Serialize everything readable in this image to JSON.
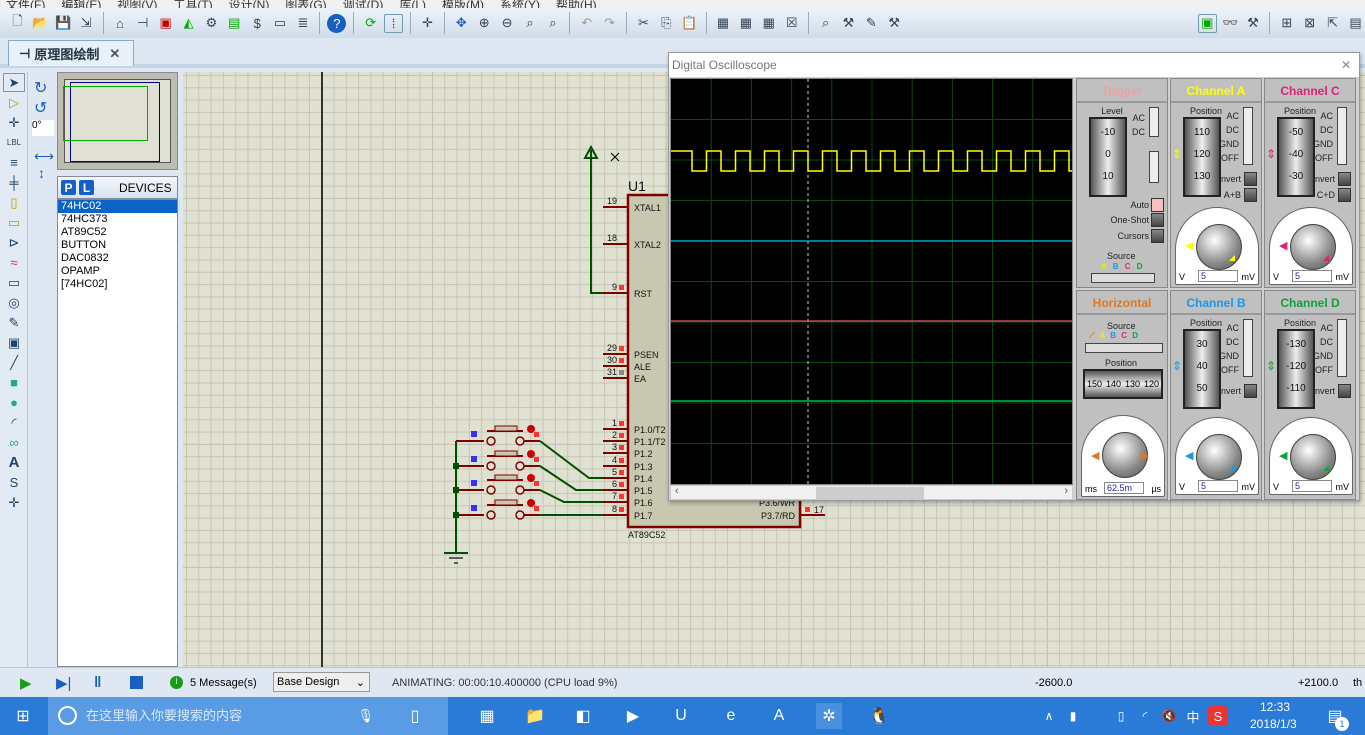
{
  "menu": [
    "文件(F)",
    "编辑(E)",
    "视图(V)",
    "工具(T)",
    "设计(N)",
    "图表(G)",
    "调试(D)",
    "库(L)",
    "模版(M)",
    "系统(Y)",
    "帮助(H)"
  ],
  "tab": {
    "label": "原理图绘制",
    "close": "✕"
  },
  "rotation": "0°",
  "devices": {
    "p": "P",
    "l": "L",
    "title": "DEVICES",
    "items": [
      "74HC02",
      "74HC373",
      "AT89C52",
      "BUTTON",
      "DAC0832",
      "OPAMP",
      "[74HC02]"
    ],
    "selected": "74HC02"
  },
  "schematic": {
    "ref": "U1",
    "part": "AT89C52",
    "pins": [
      {
        "n": "19",
        "name": "XTAL1"
      },
      {
        "n": "18",
        "name": "XTAL2"
      },
      {
        "n": "9",
        "name": "RST"
      },
      {
        "n": "29",
        "name": "PSEN"
      },
      {
        "n": "30",
        "name": "ALE"
      },
      {
        "n": "31",
        "name": "EA"
      },
      {
        "n": "1",
        "name": "P1.0/T2"
      },
      {
        "n": "2",
        "name": "P1.1/T2"
      },
      {
        "n": "3",
        "name": "P1.2"
      },
      {
        "n": "4",
        "name": "P1.3"
      },
      {
        "n": "5",
        "name": "P1.4"
      },
      {
        "n": "6",
        "name": "P1.5"
      },
      {
        "n": "7",
        "name": "P1.6"
      },
      {
        "n": "8",
        "name": "P1.7"
      }
    ],
    "right_pins": [
      {
        "n": "",
        "name": "P3.6/WR"
      },
      {
        "n": "17",
        "name": "P3.7/RD"
      }
    ]
  },
  "scope": {
    "title": "Digital Oscilloscope",
    "close": "✕",
    "traces": {
      "A": "#ffff00",
      "B": "#00c8e8",
      "C": "#e05070",
      "D": "#00e060"
    },
    "trigger": {
      "title": "Trigger",
      "level": "Level",
      "ticks": [
        "-10",
        "0",
        "10"
      ],
      "ac": "AC",
      "dc": "DC",
      "auto": "Auto",
      "oneshot": "One-Shot",
      "cursors": "Cursors",
      "source": "Source",
      "src": [
        "A",
        "B",
        "C",
        "D"
      ]
    },
    "horizontal": {
      "title": "Horizontal",
      "source": "Source",
      "src": [
        "A",
        "B",
        "C",
        "D"
      ],
      "position": "Position",
      "ticks": [
        "150",
        "140",
        "130",
        "120"
      ],
      "value": "62.5m",
      "unit_l": "ms",
      "unit_r": "µs"
    },
    "channels": [
      {
        "id": "A",
        "title": "Channel A",
        "color": "#ffff00",
        "ticks": [
          "110",
          "120",
          "130"
        ],
        "extra": "A+B",
        "value": "5"
      },
      {
        "id": "C",
        "title": "Channel C",
        "color": "#e0207a",
        "ticks": [
          "-50",
          "-40",
          "-30"
        ],
        "extra": "C+D",
        "value": "5"
      },
      {
        "id": "B",
        "title": "Channel B",
        "color": "#1e96e6",
        "ticks": [
          "30",
          "40",
          "50"
        ],
        "extra": "",
        "value": "5"
      },
      {
        "id": "D",
        "title": "Channel D",
        "color": "#10a040",
        "ticks": [
          "-130",
          "-120",
          "-110"
        ],
        "extra": "",
        "value": "5"
      }
    ],
    "position": "Position",
    "coupling": [
      "AC",
      "DC",
      "GND",
      "OFF"
    ],
    "invert": "Invert",
    "unit_l": "V",
    "unit_r": "mV"
  },
  "status": {
    "messages": "5 Message(s)",
    "design": "Base Design",
    "anim": "ANIMATING: 00:00:10.400000 (CPU load 9%)",
    "x": "-2600.0",
    "y": "+2100.0",
    "unit": "th"
  },
  "taskbar": {
    "search": "在这里输入你要搜索的内容",
    "time": "12:33",
    "date": "2018/1/3",
    "ime": "中",
    "notif": "1"
  }
}
